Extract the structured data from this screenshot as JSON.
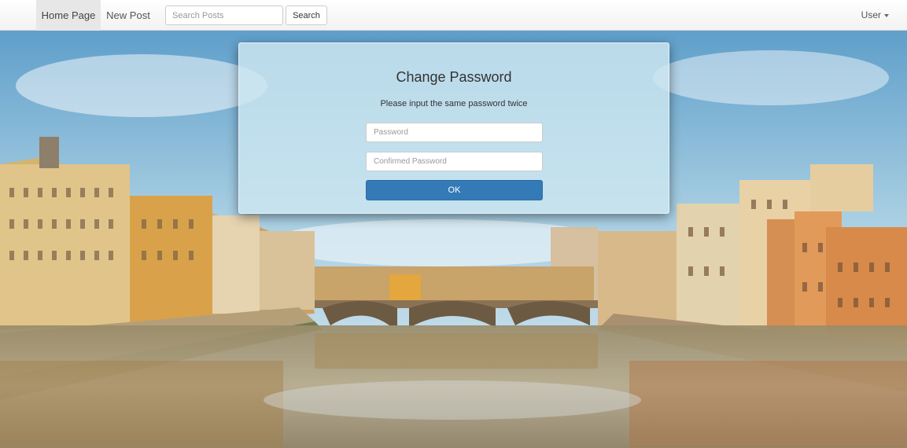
{
  "navbar": {
    "home_label": "Home Page",
    "new_post_label": "New Post",
    "search_placeholder": "Search Posts",
    "search_button_label": "Search",
    "user_label": "User"
  },
  "dialog": {
    "title": "Change Password",
    "subtitle": "Please input the same password twice",
    "password_placeholder": "Password",
    "confirm_placeholder": "Confirmed Password",
    "ok_label": "OK"
  },
  "colors": {
    "primary_button": "#337ab7",
    "navbar_active": "#e7e7e7"
  }
}
